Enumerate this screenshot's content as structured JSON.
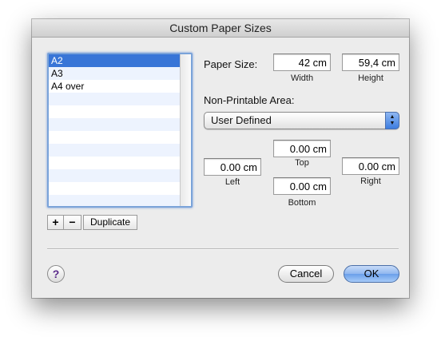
{
  "window": {
    "title": "Custom Paper Sizes"
  },
  "list": {
    "items": [
      "A2",
      "A3",
      "A4 over",
      "",
      "",
      "",
      "",
      "",
      "",
      "",
      "",
      ""
    ],
    "selected_index": 0
  },
  "list_buttons": {
    "add": "+",
    "remove": "−",
    "duplicate": "Duplicate"
  },
  "paper_size": {
    "label": "Paper Size:",
    "width_value": "42 cm",
    "width_label": "Width",
    "height_value": "59,4 cm",
    "height_label": "Height"
  },
  "non_printable": {
    "label": "Non-Printable Area:",
    "selected": "User Defined",
    "top_value": "0.00 cm",
    "top_label": "Top",
    "left_value": "0.00 cm",
    "left_label": "Left",
    "right_value": "0.00 cm",
    "right_label": "Right",
    "bottom_value": "0.00 cm",
    "bottom_label": "Bottom"
  },
  "footer": {
    "help": "?",
    "cancel": "Cancel",
    "ok": "OK"
  },
  "colors": {
    "selection": "#3875d7",
    "accent": "#6a9fea"
  }
}
